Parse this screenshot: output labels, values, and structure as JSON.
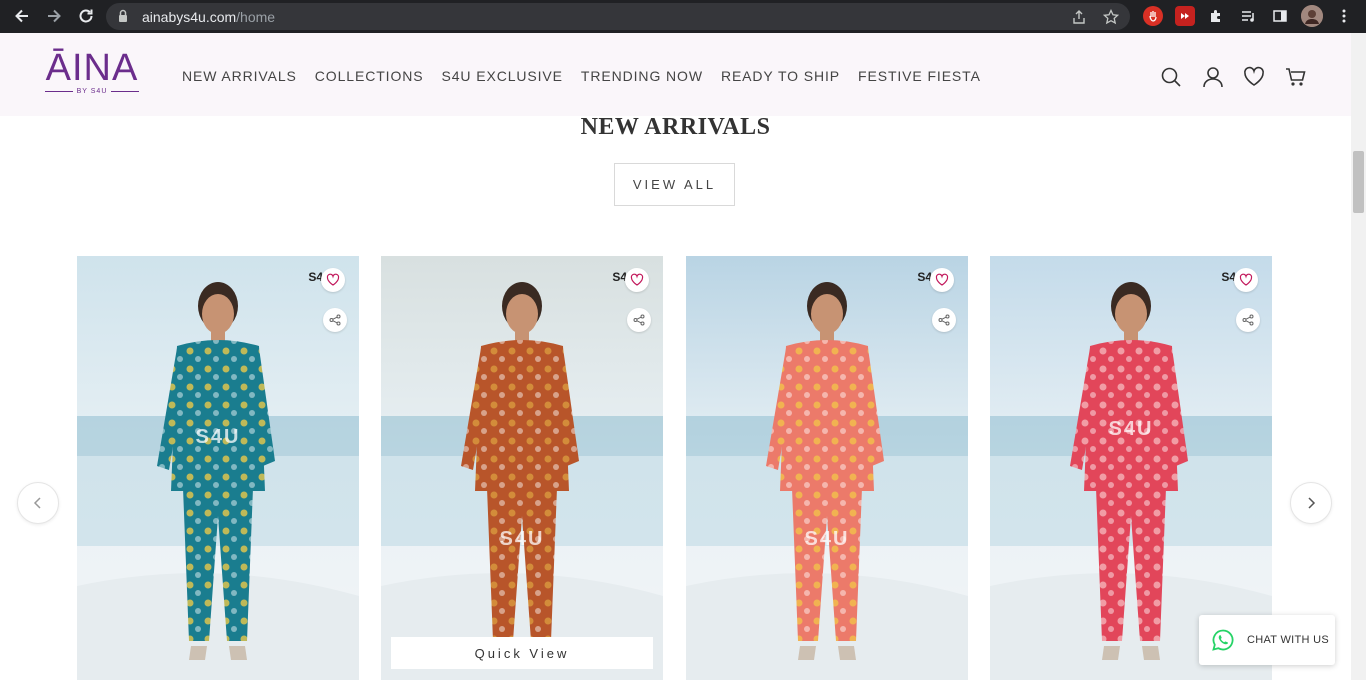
{
  "browser": {
    "url_host": "ainabys4u.com",
    "url_path": "/home",
    "icons": [
      "back-icon",
      "forward-icon",
      "reload-icon",
      "lock-icon",
      "share-page-icon",
      "bookmark-star-icon",
      "extension-icon",
      "puzzle-icon",
      "media-icon",
      "sidepanel-icon",
      "profile-avatar"
    ]
  },
  "header": {
    "logo_text": "ĀINA",
    "logo_subtext": "BY S4U",
    "nav": [
      {
        "label": "NEW ARRIVALS"
      },
      {
        "label": "COLLECTIONS"
      },
      {
        "label": "S4U EXCLUSIVE"
      },
      {
        "label": "TRENDING NOW"
      },
      {
        "label": "READY TO SHIP"
      },
      {
        "label": "FESTIVE FIESTA"
      }
    ],
    "icons": [
      "search-icon",
      "account-icon",
      "wishlist-icon",
      "cart-icon"
    ],
    "accent_color": "#6b2d8c"
  },
  "section": {
    "title": "NEW ARRIVALS",
    "view_all_label": "VIEW ALL"
  },
  "products": [
    {
      "brand_mark": "S4",
      "outfit_color": "#1a7d8f",
      "accent": "#e8c84a",
      "quick_view": ""
    },
    {
      "brand_mark": "S4",
      "outfit_color": "#b8552a",
      "accent": "#d99a3e",
      "quick_view": "Quick View"
    },
    {
      "brand_mark": "S4",
      "outfit_color": "#ec7a6a",
      "accent": "#f2c24b",
      "quick_view": ""
    },
    {
      "brand_mark": "S4",
      "outfit_color": "#e2465a",
      "accent": "#f5b3b8",
      "quick_view": ""
    }
  ],
  "watermark": "S4U",
  "chat": {
    "label": "CHAT WITH US",
    "color": "#25d366"
  }
}
